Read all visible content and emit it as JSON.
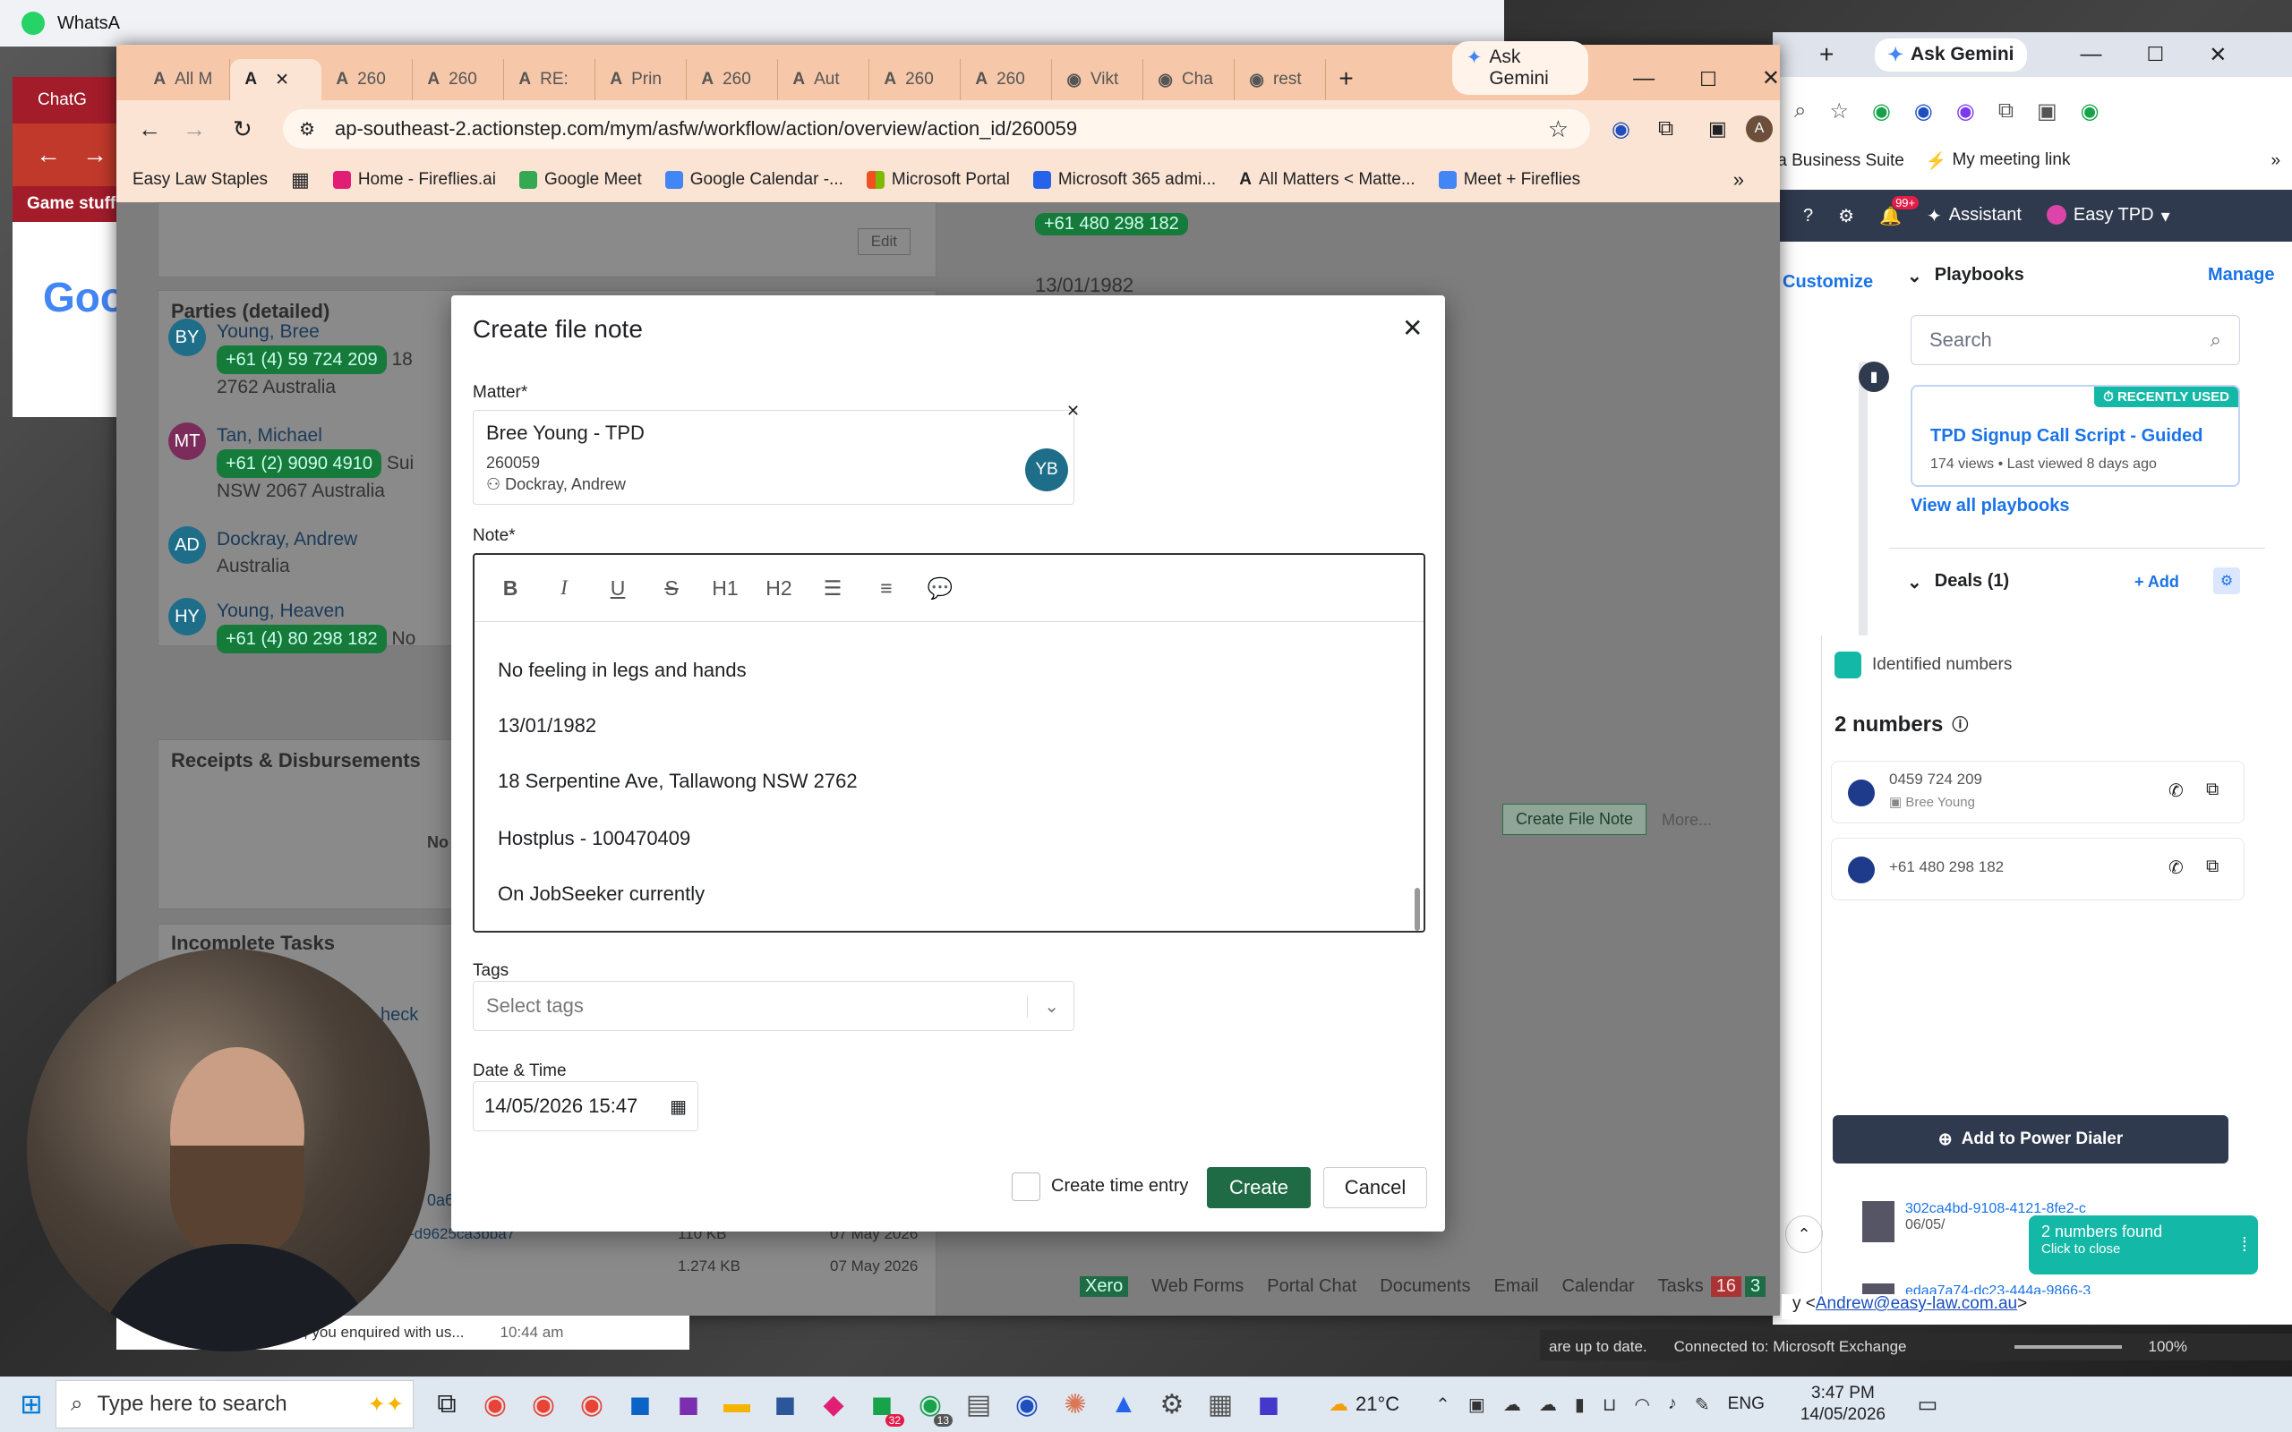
{
  "background": {
    "whatsapp_title": "WhatsA",
    "left_tab": "ChatG",
    "left_fav": "Game stuff",
    "left_logo": "Goo"
  },
  "right_window": {
    "gemini": "Ask Gemini",
    "bm1": "ta Business Suite",
    "bm2": "My meeting link",
    "assistant": "Assistant",
    "user": "Easy TPD",
    "notif": "99+",
    "customize": "Customize",
    "playbooks": "Playbooks",
    "manage": "Manage",
    "search_placeholder": "Search",
    "recently_used": "RECENTLY USED",
    "playbook_title": "TPD Signup Call Script - Guided",
    "playbook_meta": "174 views • Last viewed 8 days ago",
    "view_all": "View all playbooks",
    "deals": "Deals (1)",
    "add": "Add",
    "identified": "Identified numbers",
    "numbers_count": "2 numbers",
    "num1": "0459 724 209",
    "num1_name": "Bree Young",
    "num2": "+61 480 298 182",
    "power_dialer": "Add to Power Dialer",
    "toast_title": "2 numbers found",
    "toast_sub": "Click to close",
    "file1": "302ca4bd-9108-4121-8fe2-c",
    "file1_date": "06/05/",
    "file2": "edaa7a74-dc23-444a-9866-3"
  },
  "browser": {
    "tabs": [
      "All M",
      "",
      "260",
      "260",
      "RE:",
      "Prin",
      "260",
      "Aut",
      "260",
      "260",
      "Vikt",
      "Cha",
      "rest"
    ],
    "gemini": "Ask Gemini",
    "url": "ap-southeast-2.actionstep.com/mym/asfw/workflow/action/overview/action_id/260059",
    "bookmarks": [
      "Easy Law Staples",
      "Home - Fireflies.ai",
      "Google Meet",
      "Google Calendar -...",
      "Microsoft Portal",
      "Microsoft 365 admi...",
      "All Matters < Matte...",
      "Meet + Fireflies"
    ],
    "profile": "A"
  },
  "page": {
    "edit": "Edit",
    "phone_top": "+61 480 298 182",
    "dob": "13/01/1982",
    "parties_title": "Parties (detailed)",
    "parties": [
      {
        "initials": "BY",
        "name": "Young, Bree",
        "phone": "+61 (4) 59 724 209",
        "extra": "18",
        "line2": "2762 Australia",
        "color": "#1e6e8a"
      },
      {
        "initials": "MT",
        "name": "Tan, Michael",
        "phone": "+61 (2) 9090 4910",
        "extra": "Sui",
        "line2": "NSW 2067 Australia",
        "color": "#7b2c5a"
      },
      {
        "initials": "AD",
        "name": "Dockray, Andrew",
        "phone": "",
        "extra": "",
        "line2": "Australia",
        "color": "#1e6e8a"
      },
      {
        "initials": "HY",
        "name": "Young, Heaven",
        "phone": "+61 (4) 80 298 182",
        "extra": "No",
        "line2": "",
        "color": "#1e6e8a"
      }
    ],
    "receipts_title": "Receipts & Disbursements",
    "no_rec": "No re",
    "create_file_note_btn": "Create File Note",
    "more": "More...",
    "incomplete_tasks": "Incomplete Tasks",
    "check": "heck",
    "doc_rows": [
      {
        "name": "0a6",
        "size": "",
        "date": ""
      },
      {
        "name": "-d9625ca3bba7",
        "size": "110 KB",
        "date": "07 May 2026"
      },
      {
        "name": "",
        "size": "1.274 KB",
        "date": "07 May 2026"
      }
    ],
    "chat_preview": "Hi Simon, you enquired with us...",
    "chat_time": "10:44 am",
    "bottom_nav": [
      "Xero",
      "Web Forms",
      "Portal Chat",
      "Documents",
      "Email",
      "Calendar",
      "Tasks"
    ],
    "tasks_red": "16",
    "tasks_green": "3"
  },
  "modal": {
    "title": "Create file note",
    "matter_label": "Matter*",
    "matter_name": "Bree Young - TPD",
    "matter_id": "260059",
    "matter_person": "Dockray, Andrew",
    "matter_avatar": "YB",
    "note_label": "Note*",
    "toolbar": {
      "bold": "B",
      "italic": "I",
      "underline": "U",
      "strike": "S",
      "h1": "H1",
      "h2": "H2"
    },
    "note_lines": [
      "No feeling in legs and hands",
      "13/01/1982",
      "18 Serpentine Ave, Tallawong NSW 2762",
      "Hostplus - 100470409",
      "On JobSeeker currently"
    ],
    "tags_label": "Tags",
    "tags_placeholder": "Select tags",
    "datetime_label": "Date & Time",
    "datetime_value": "14/05/2026 15:47",
    "time_entry": "Create time entry",
    "create": "Create",
    "cancel": "Cancel"
  },
  "status_bar": {
    "email": "Andrew@easy-law.com.au",
    "up_to_date": "are up to date.",
    "exchange": "Connected to: Microsoft Exchange",
    "zoom": "100%"
  },
  "taskbar": {
    "search_placeholder": "Type here to search",
    "temp": "21°C",
    "lang": "ENG",
    "time": "3:47 PM",
    "date": "14/05/2026",
    "badge1": "32",
    "badge2": "13"
  }
}
